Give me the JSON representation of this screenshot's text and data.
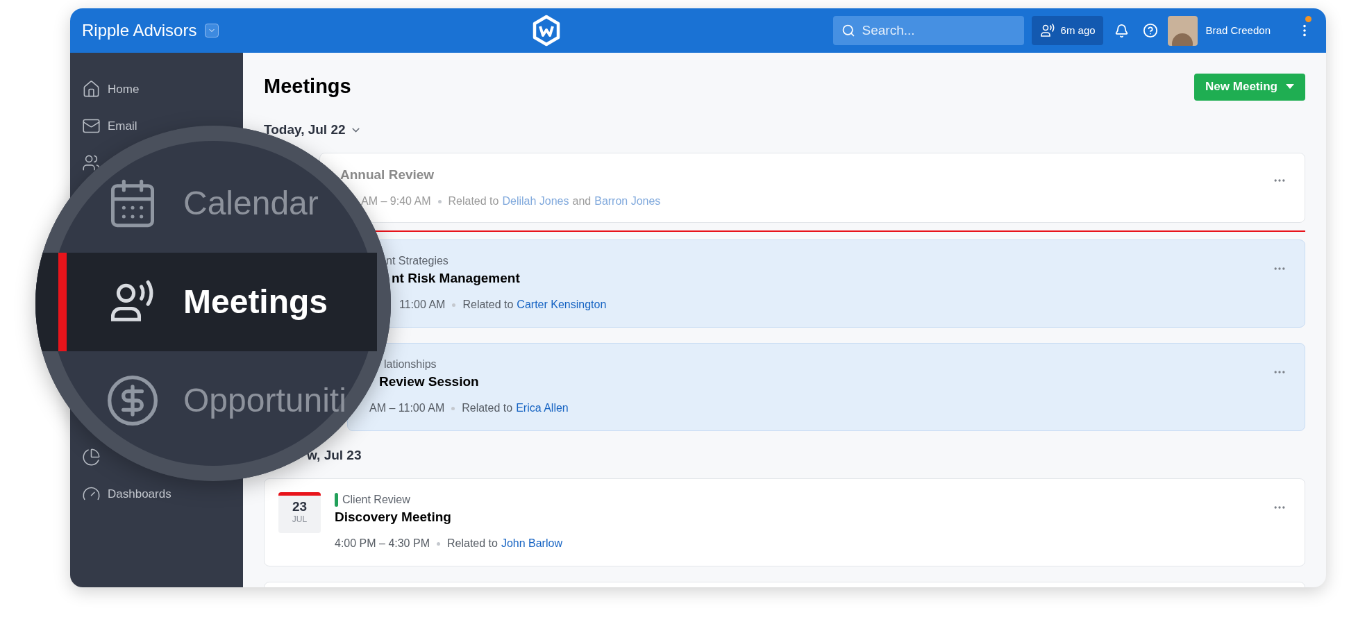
{
  "topbar": {
    "org": "Ripple Advisors",
    "search": {
      "placeholder": "Search..."
    },
    "recent": "6m ago",
    "user": "Brad Creedon",
    "notification_dot": true
  },
  "sidebar": {
    "items": [
      {
        "label": "Home"
      },
      {
        "label": "Email"
      },
      {
        "kind": "icon-only"
      },
      {
        "kind": "gap"
      },
      {
        "kind": "icon-only"
      },
      {
        "label": "Dashboards"
      }
    ]
  },
  "page": {
    "title": "Meetings",
    "new_button": "New Meeting"
  },
  "days": [
    {
      "label": "Today, Jul 22",
      "dropdown": true,
      "items": [
        {
          "kind": "meeting",
          "past": true,
          "current": false,
          "title": "Annual Review",
          "time": "AM – 9:40 AM",
          "related_label": "Related to",
          "links": [
            "Delilah Jones",
            "Barron Jones"
          ],
          "joiner": "and"
        },
        {
          "kind": "now-marker"
        },
        {
          "kind": "meeting",
          "past": false,
          "current": true,
          "category": "nt Strategies",
          "title": "nt Risk Management",
          "time": "11:00 AM",
          "related_label": "Related to",
          "links": [
            "Carter Kensington"
          ]
        },
        {
          "kind": "meeting",
          "past": false,
          "current": true,
          "category": "lationships",
          "title": "Review Session",
          "time": "AM – 11:00 AM",
          "related_label": "Related to",
          "links": [
            "Erica Allen"
          ]
        }
      ]
    },
    {
      "label": "w, Jul 23",
      "dropdown": false,
      "items": [
        {
          "kind": "meeting",
          "past": false,
          "current": false,
          "day": "23",
          "month": "JUL",
          "category": "Client Review",
          "color": "#22a05a",
          "title": "Discovery Meeting",
          "time": "4:00 PM – 4:30 PM",
          "related_label": "Related to",
          "links": [
            "John Barlow"
          ]
        },
        {
          "kind": "clipped-card"
        }
      ]
    }
  ],
  "magnifier": {
    "items": [
      {
        "label": "Calendar",
        "selected": false
      },
      {
        "label": "Meetings",
        "selected": true
      },
      {
        "label": "Opportuniti",
        "selected": false
      }
    ]
  }
}
